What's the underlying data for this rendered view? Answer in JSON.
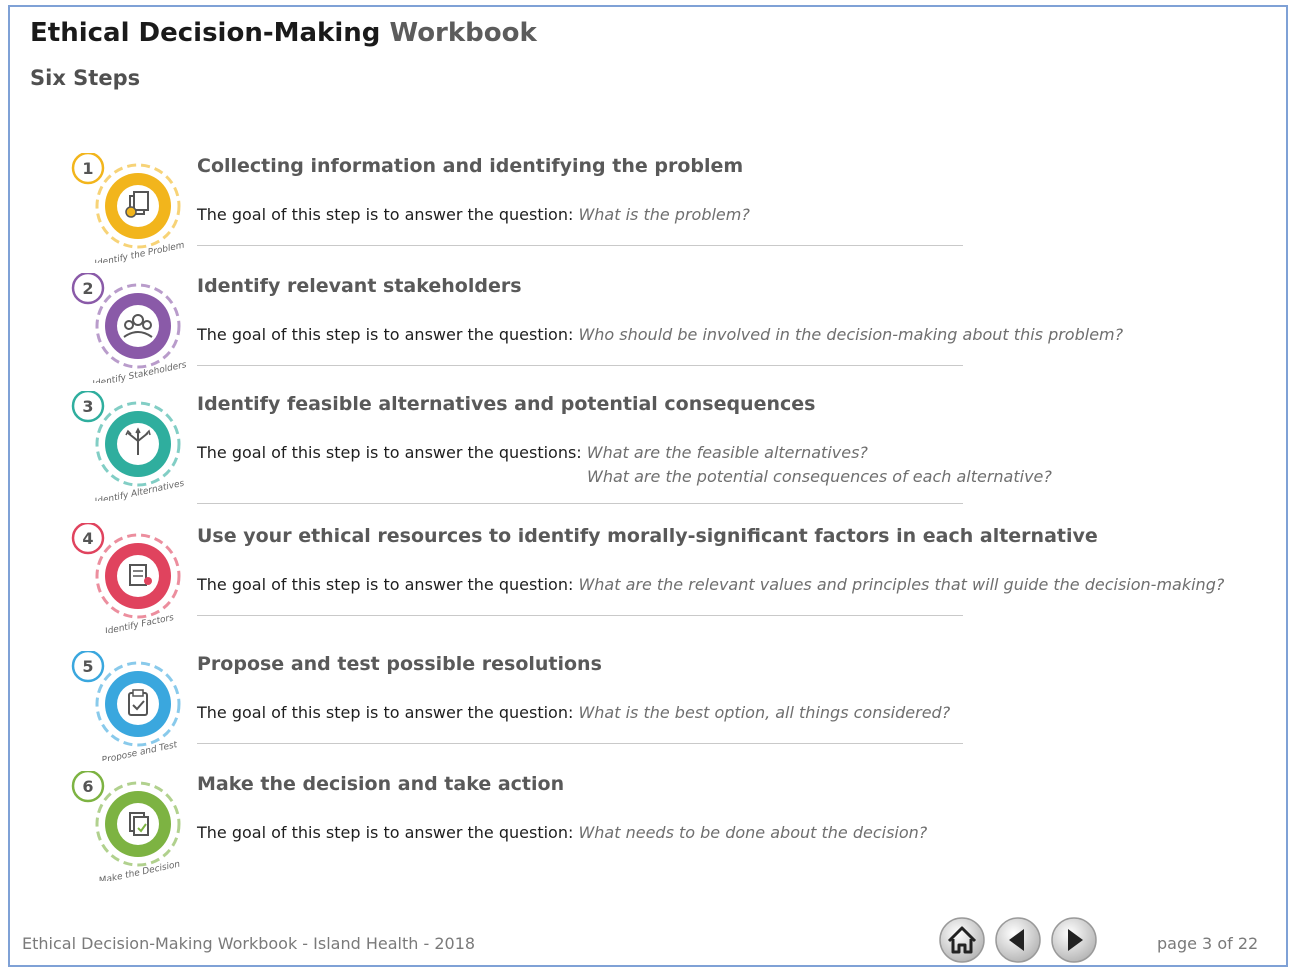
{
  "header": {
    "title_main": "Ethical Decision-Making",
    "title_sub": "Workbook",
    "subtitle": "Six Steps"
  },
  "colors": {
    "step1": "#f2b51c",
    "step2": "#8a5aa8",
    "step3": "#2fae9e",
    "step4": "#e0435e",
    "step5": "#3aa7de",
    "step6": "#7db342"
  },
  "steps": [
    {
      "number": "1",
      "icon": "puzzle-pages-icon",
      "icon_label": "Identify the Problem",
      "title": "Collecting information and identifying the problem",
      "goal_prefix": "The goal of this step is to answer the question: ",
      "question": "What is the problem?",
      "question2": ""
    },
    {
      "number": "2",
      "icon": "people-group-icon",
      "icon_label": "Identify Stakeholders",
      "title": "Identify relevant stakeholders",
      "goal_prefix": "The goal of this step is to answer the question: ",
      "question": "Who should be involved in the decision-making about this problem?",
      "question2": ""
    },
    {
      "number": "3",
      "icon": "branching-arrows-icon",
      "icon_label": "Identify Alternatives",
      "title": "Identify feasible alternatives and potential consequences",
      "goal_prefix": "The goal of this step is to answer the questions: ",
      "question": "What are the feasible alternatives?",
      "question2": "What are the potential consequences of each alternative?"
    },
    {
      "number": "4",
      "icon": "factors-document-icon",
      "icon_label": "Identify Factors",
      "title": "Use your ethical resources to identify morally-significant factors in each alternative",
      "goal_prefix": "The goal of this step is to answer the question: ",
      "question": "What are the relevant values and principles that will guide the decision-making?",
      "question2": ""
    },
    {
      "number": "5",
      "icon": "clipboard-icon",
      "icon_label": "Propose and Test",
      "title": "Propose and test possible resolutions",
      "goal_prefix": "The goal of this step is to answer the question: ",
      "question": "What is the best option, all things considered?",
      "question2": ""
    },
    {
      "number": "6",
      "icon": "decision-pages-icon",
      "icon_label": "Make the Decision",
      "title": "Make the decision and take action",
      "goal_prefix": "The goal of this step is to answer the question: ",
      "question": "What needs to be done about the decision?",
      "question2": ""
    }
  ],
  "footer": {
    "text": "Ethical Decision-Making Workbook - Island Health - 2018",
    "page": "page 3 of 22",
    "nav_icons": [
      "home-icon",
      "arrow-left-icon",
      "arrow-right-icon"
    ]
  }
}
